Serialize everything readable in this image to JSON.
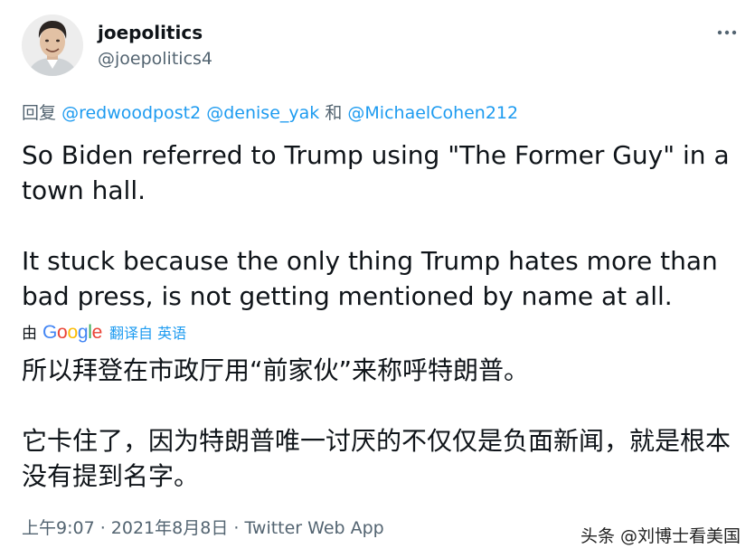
{
  "user": {
    "display_name": "joepolitics",
    "handle": "@joepolitics4"
  },
  "reply": {
    "prefix": "回复",
    "mentions": [
      "@redwoodpost2",
      "@denise_yak"
    ],
    "conjunction": "和",
    "last_mention": "@MichaelCohen212"
  },
  "tweet": {
    "paragraph_1": "So Biden referred to Trump using \"The Former Guy\" in a town hall.",
    "paragraph_2": "It stuck because the only thing Trump hates more than bad press, is not getting mentioned by name at all."
  },
  "translation_attribution": {
    "by": "由",
    "google_letters": [
      "G",
      "o",
      "o",
      "g",
      "l",
      "e"
    ],
    "google_colors": [
      "#4285F4",
      "#EA4335",
      "#FBBC05",
      "#4285F4",
      "#34A853",
      "#EA4335"
    ],
    "link": "翻译自 英语"
  },
  "translation": {
    "paragraph_1": "所以拜登在市政厅用“前家伙”来称呼特朗普。",
    "paragraph_2": "它卡住了，因为特朗普唯一讨厌的不仅仅是负面新闻，就是根本没有提到名字。"
  },
  "footer": {
    "time_date": "上午9:07 · 2021年8月8日 · ",
    "source": "Twitter Web App"
  },
  "watermark": "头条 @刘博士看美国",
  "icons": {
    "more": "more-horizontal-icon",
    "avatar": "avatar-portrait"
  },
  "colors": {
    "link": "#1d9bf0",
    "secondary_text": "#536471",
    "primary_text": "#0f1419"
  }
}
